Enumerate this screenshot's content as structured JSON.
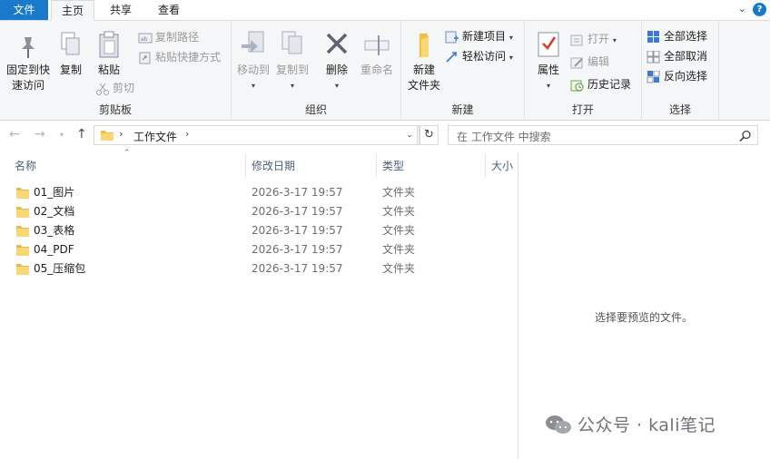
{
  "tabs": {
    "file": "文件",
    "home": "主页",
    "share": "共享",
    "view": "查看"
  },
  "ribbon": {
    "clipboard": {
      "pin": "固定到快",
      "pin2": "速访问",
      "copy": "复制",
      "paste": "粘贴",
      "copy_path": "复制路径",
      "paste_shortcut": "粘贴快捷方式",
      "cut": "剪切",
      "label": "剪贴板"
    },
    "organize": {
      "move_to": "移动到",
      "copy_to": "复制到",
      "delete": "删除",
      "rename": "重命名",
      "label": "组织"
    },
    "new": {
      "new_folder": "新建",
      "new_folder2": "文件夹",
      "new_item": "新建项目",
      "easy_access": "轻松访问",
      "label": "新建"
    },
    "open": {
      "properties": "属性",
      "open": "打开",
      "edit": "编辑",
      "history": "历史记录",
      "label": "打开"
    },
    "select": {
      "select_all": "全部选择",
      "select_none": "全部取消",
      "invert": "反向选择",
      "label": "选择"
    }
  },
  "address": {
    "crumb": "工作文件",
    "search_placeholder": "在 工作文件 中搜索"
  },
  "columns": {
    "name": "名称",
    "date": "修改日期",
    "type": "类型",
    "size": "大小"
  },
  "files": [
    {
      "name": "01_图片",
      "date": "2026-3-17 19:57",
      "type": "文件夹"
    },
    {
      "name": "02_文档",
      "date": "2026-3-17 19:57",
      "type": "文件夹"
    },
    {
      "name": "03_表格",
      "date": "2026-3-17 19:57",
      "type": "文件夹"
    },
    {
      "name": "04_PDF",
      "date": "2026-3-17 19:57",
      "type": "文件夹"
    },
    {
      "name": "05_压缩包",
      "date": "2026-3-17 19:57",
      "type": "文件夹"
    }
  ],
  "preview": {
    "empty_text": "选择要预览的文件。"
  },
  "watermark": {
    "text": "公众号 · kali笔记"
  },
  "colors": {
    "accent": "#1979ca",
    "folder": "#f8d775",
    "folder_dark": "#e6b84f"
  }
}
